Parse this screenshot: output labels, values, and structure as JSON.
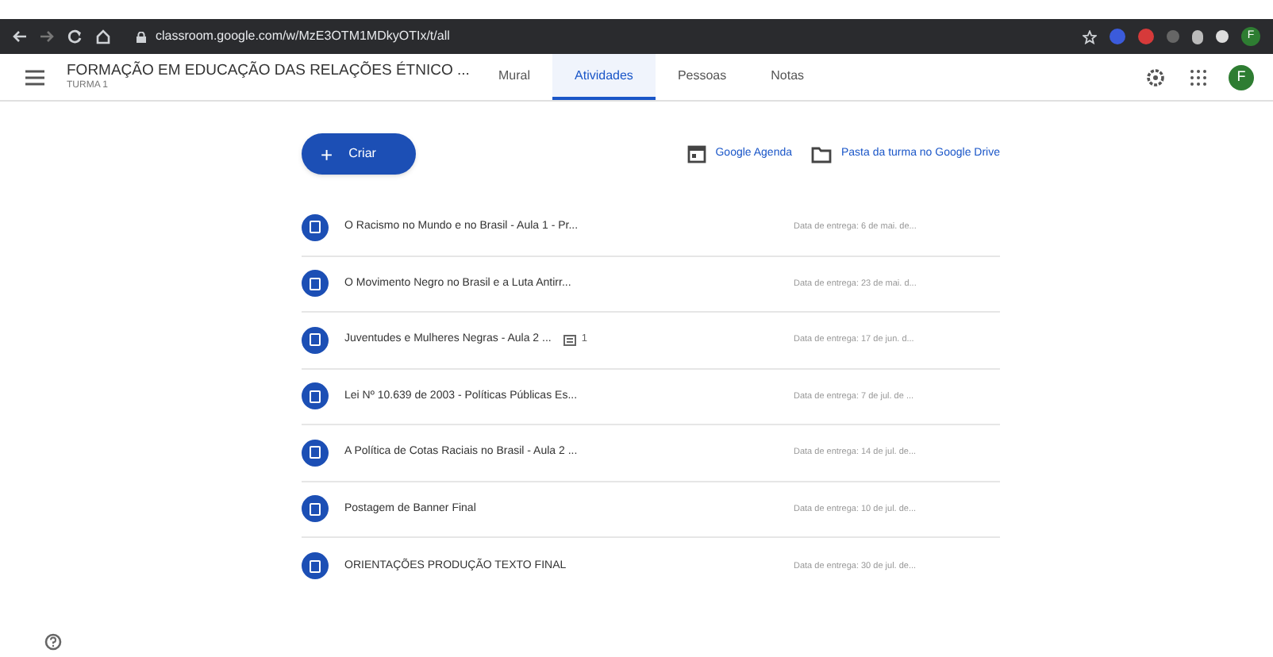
{
  "browser": {
    "url": "classroom.google.com/w/MzE3OTM1MDkyOTIx/t/all",
    "profile": "F"
  },
  "header": {
    "title": "FORMAÇÃO EM EDUCAÇÃO DAS RELAÇÕES ÉTNICO ...",
    "subtitle": "TURMA 1",
    "avatar": "F"
  },
  "tabs": [
    {
      "label": "Mural",
      "selected": false
    },
    {
      "label": "Atividades",
      "selected": true
    },
    {
      "label": "Pessoas",
      "selected": false
    },
    {
      "label": "Notas",
      "selected": false
    }
  ],
  "create_button": {
    "label": "Criar",
    "icon": "+"
  },
  "links": [
    {
      "kind": "calendar",
      "label": "Google Agenda"
    },
    {
      "kind": "folder",
      "label": "Pasta da turma no Google Drive"
    }
  ],
  "assignments": [
    {
      "title": "O Racismo no Mundo e no Brasil - Aula 1 - Pr...",
      "due": "Data de entrega: 6 de mai. de..."
    },
    {
      "title": "O Movimento Negro no Brasil e a Luta Antirr...",
      "due": "Data de entrega: 23 de mai. d..."
    },
    {
      "title": "Juventudes e Mulheres Negras - Aula 2 ...",
      "comments": "1",
      "due": "Data de entrega: 17 de jun. d..."
    },
    {
      "title": "Lei Nº 10.639 de 2003 - Políticas Públicas Es...",
      "due": "Data de entrega: 7 de jul. de ..."
    },
    {
      "title": "A Política de Cotas Raciais no Brasil - Aula 2 ...",
      "due": "Data de entrega: 14 de jul. de..."
    },
    {
      "title": "Postagem de Banner Final",
      "due": "Data de entrega: 10 de jul. de..."
    },
    {
      "title": "ORIENTAÇÕES PRODUÇÃO TEXTO FINAL",
      "due": "Data de entrega: 30 de jul. de..."
    }
  ]
}
